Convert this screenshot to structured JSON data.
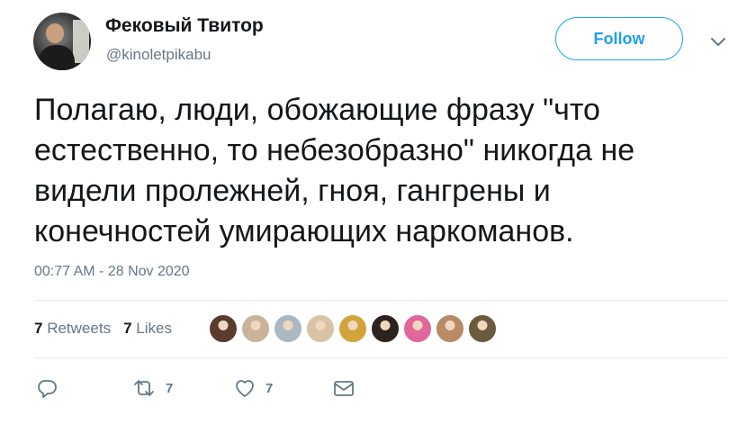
{
  "author": {
    "name": "Фековый Твитор",
    "handle": "@kinoletpikabu"
  },
  "follow_label": "Follow",
  "tweet_text": "Полагаю, люди, обожающие фразу \"что\nестественно, то небезобразно\" никогда не\nвидели пролежней, гноя, гангрены и\nконечностей умирающих наркоманов.",
  "timestamp": "00:77 AM - 28 Nov 2020",
  "stats": {
    "retweets_count": "7",
    "retweets_label": "Retweets",
    "likes_count": "7",
    "likes_label": "Likes"
  },
  "likers": [
    {
      "color": "#5a3b2e"
    },
    {
      "color": "#c9b39a"
    },
    {
      "color": "#aab8c2"
    },
    {
      "color": "#d8c3a5"
    },
    {
      "color": "#d1a33a"
    },
    {
      "color": "#2b2320"
    },
    {
      "color": "#e0679a"
    },
    {
      "color": "#b88a66"
    },
    {
      "color": "#6b5a3e"
    }
  ],
  "actions": {
    "reply_icon": "reply-icon",
    "retweet_icon": "retweet-icon",
    "retweet_count": "7",
    "like_icon": "heart-icon",
    "like_count": "7",
    "message_icon": "envelope-icon"
  },
  "colors": {
    "accent": "#1da1f2",
    "secondary_text": "#657786",
    "divider": "#e6ecf0"
  }
}
